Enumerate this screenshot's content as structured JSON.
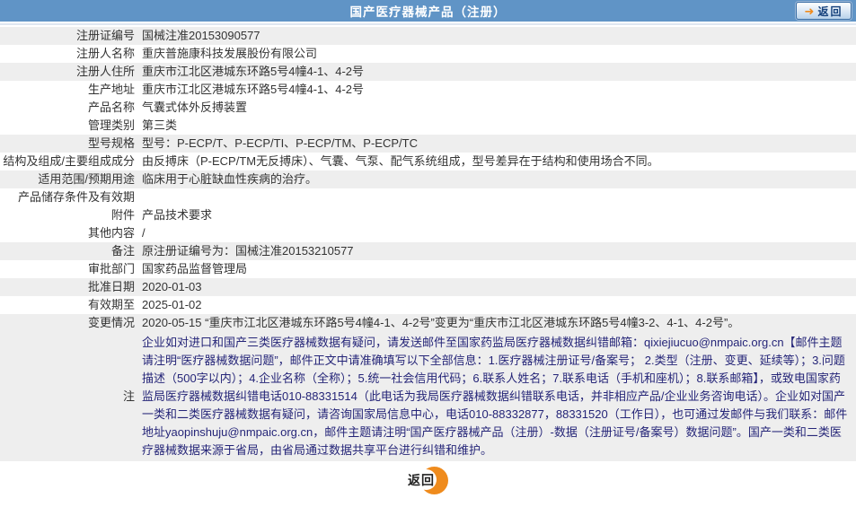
{
  "header": {
    "title": "国产医疗器械产品（注册）",
    "back_label": "返回"
  },
  "footer": {
    "back_label": "返回"
  },
  "rows": [
    {
      "id": "reg_cert_no",
      "label": "注册证编号",
      "value": "国械注准20153090577",
      "shaded": true
    },
    {
      "id": "registrant",
      "label": "注册人名称",
      "value": "重庆普施康科技发展股份有限公司",
      "shaded": false
    },
    {
      "id": "reg_address",
      "label": "注册人住所",
      "value": "重庆市江北区港城东环路5号4幢4-1、4-2号",
      "shaded": true
    },
    {
      "id": "prod_address",
      "label": "生产地址",
      "value": "重庆市江北区港城东环路5号4幢4-1、4-2号",
      "shaded": false
    },
    {
      "id": "product_name",
      "label": "产品名称",
      "value": "气囊式体外反搏装置",
      "shaded": false
    },
    {
      "id": "mgmt_class",
      "label": "管理类别",
      "value": "第三类",
      "shaded": false
    },
    {
      "id": "model_spec",
      "label": "型号规格",
      "value": "型号：P-ECP/T、P-ECP/TI、P-ECP/TM、P-ECP/TC",
      "shaded": true
    },
    {
      "id": "composition",
      "label": "结构及组成/主要组成成分",
      "value": "由反搏床（P-ECP/TM无反搏床）、气囊、气泵、配气系统组成，型号差异在于结构和使用场合不同。",
      "shaded": false
    },
    {
      "id": "intended_use",
      "label": "适用范围/预期用途",
      "value": "临床用于心脏缺血性疾病的治疗。",
      "shaded": true
    },
    {
      "id": "storage",
      "label": "产品储存条件及有效期",
      "value": "",
      "shaded": false
    },
    {
      "id": "attachment",
      "label": "附件",
      "value": "产品技术要求",
      "shaded": false
    },
    {
      "id": "other_content",
      "label": "其他内容",
      "value": "/",
      "shaded": false
    },
    {
      "id": "remark",
      "label": "备注",
      "value": "原注册证编号为：国械注准20153210577",
      "shaded": true
    },
    {
      "id": "approval_dept",
      "label": "审批部门",
      "value": "国家药品监督管理局",
      "shaded": false
    },
    {
      "id": "approval_date",
      "label": "批准日期",
      "value": "2020-01-03",
      "shaded": true
    },
    {
      "id": "valid_until",
      "label": "有效期至",
      "value": "2025-01-02",
      "shaded": false
    },
    {
      "id": "changes",
      "label": "变更情况",
      "value": "2020-05-15 “重庆市江北区港城东环路5号4幢4-1、4-2号”变更为“重庆市江北区港城东环路5号4幢3-2、4-1、4-2号”。",
      "shaded": true
    },
    {
      "id": "note",
      "label": "注",
      "value": "企业如对进口和国产三类医疗器械数据有疑问，请发送邮件至国家药监局医疗器械数据纠错邮箱：qixiejiucuo@nmpaic.org.cn【邮件主题请注明“医疗器械数据问题”，邮件正文中请准确填写以下全部信息：1.医疗器械注册证号/备案号； 2.类型（注册、变更、延续等）；3.问题描述（500字以内）；4.企业名称（全称）；5.统一社会信用代码；6.联系人姓名；7.联系电话（手机和座机）；8.联系邮箱】，或致电国家药监局医疗器械数据纠错电话010-88331514（此电话为我局医疗器械数据纠错联系电话，并非相应产品/企业业务咨询电话）。企业如对国产一类和二类医疗器械数据有疑问，请咨询国家局信息中心，电话010-88332877，88331520（工作日），也可通过发邮件与我们联系：邮件地址yaopinshuju@nmpaic.org.cn，邮件主题请注明“国产医疗器械产品（注册）-数据（注册证号/备案号）数据问题”。国产一类和二类医疗器械数据来源于省局，由省局通过数据共享平台进行纠错和维护。",
      "shaded": true,
      "style": "note"
    }
  ],
  "colors": {
    "header_bg": "#6094c6",
    "header_text": "#ffffff",
    "shaded_row": "#eeeeee",
    "body_text": "#333333",
    "note_text": "#252578",
    "accent_orange": "#ef8b1d",
    "button_border": "#3a6ea5",
    "button_text": "#15417c"
  }
}
